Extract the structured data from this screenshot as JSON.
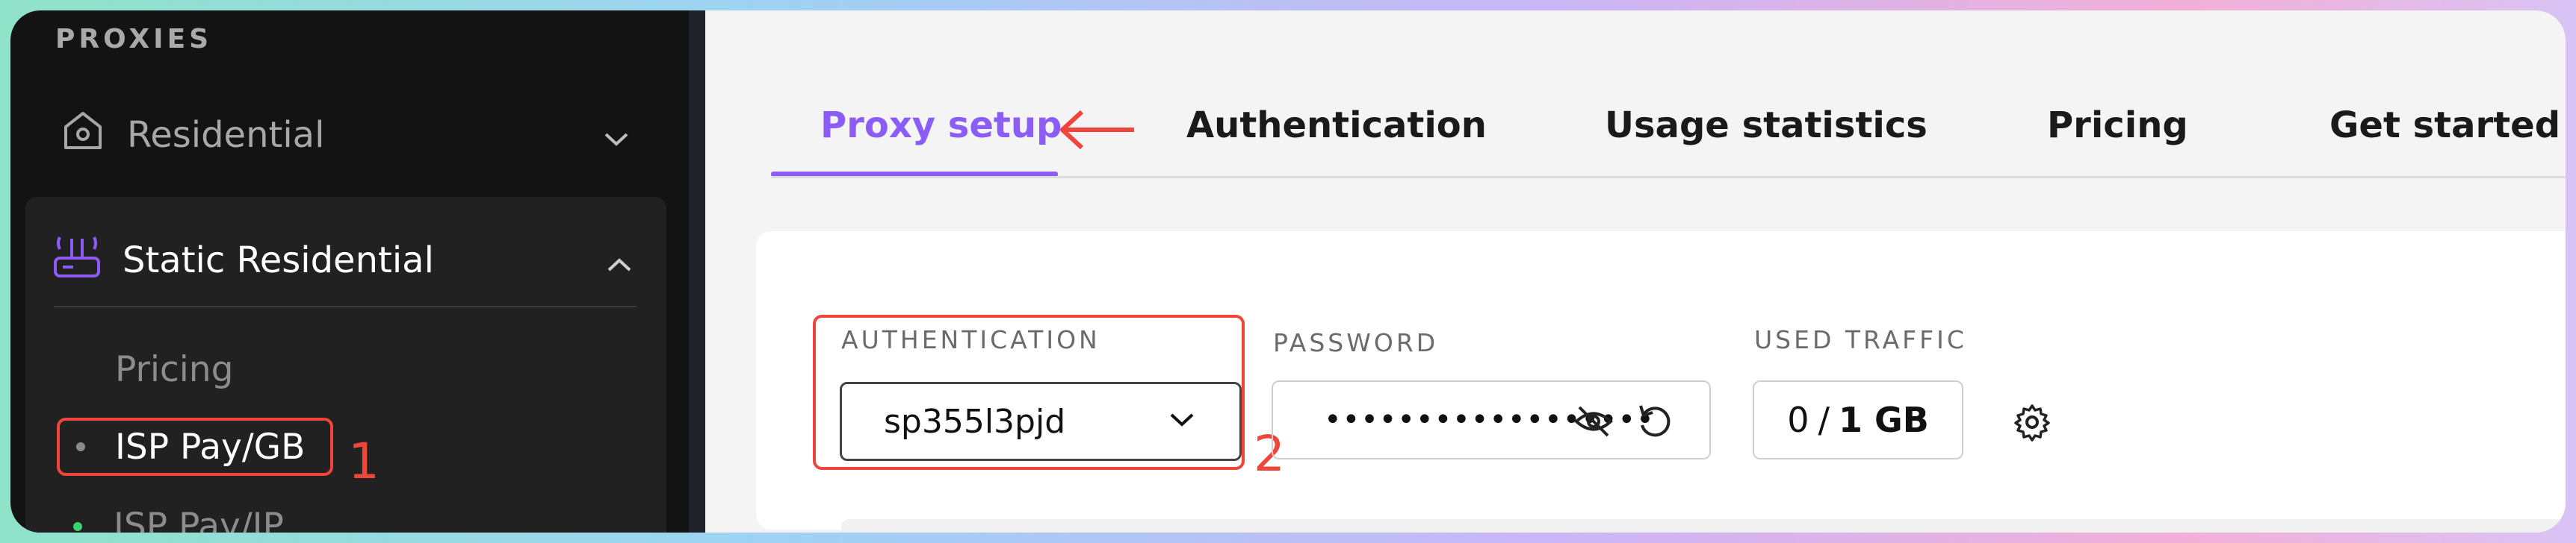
{
  "sidebar": {
    "section_title": "PROXIES",
    "items": [
      {
        "label": "Residential",
        "icon": "home-icon",
        "expanded": false
      },
      {
        "label": "Static Residential",
        "icon": "router-icon",
        "expanded": true,
        "sub_items": [
          {
            "label": "Pricing"
          },
          {
            "label": "ISP Pay/GB",
            "annotation": "1"
          },
          {
            "label": "ISP Pay/IP"
          }
        ]
      }
    ]
  },
  "tabs": [
    {
      "label": "Proxy setup",
      "active": true
    },
    {
      "label": "Authentication"
    },
    {
      "label": "Usage statistics"
    },
    {
      "label": "Pricing"
    },
    {
      "label": "Get started"
    }
  ],
  "form": {
    "auth_label": "AUTHENTICATION",
    "auth_value": "sp355l3pjd",
    "auth_annotation": "2",
    "password_label": "PASSWORD",
    "password_masked": "••••••••••••••••••",
    "traffic_label": "USED TRAFFIC",
    "traffic_used": "0",
    "traffic_sep": "/",
    "traffic_total": "1 GB"
  },
  "colors": {
    "accent": "#8b5cf6",
    "annotation_red": "#f0453a",
    "sidebar_bg": "#131313",
    "status_green": "#3ad26a"
  }
}
